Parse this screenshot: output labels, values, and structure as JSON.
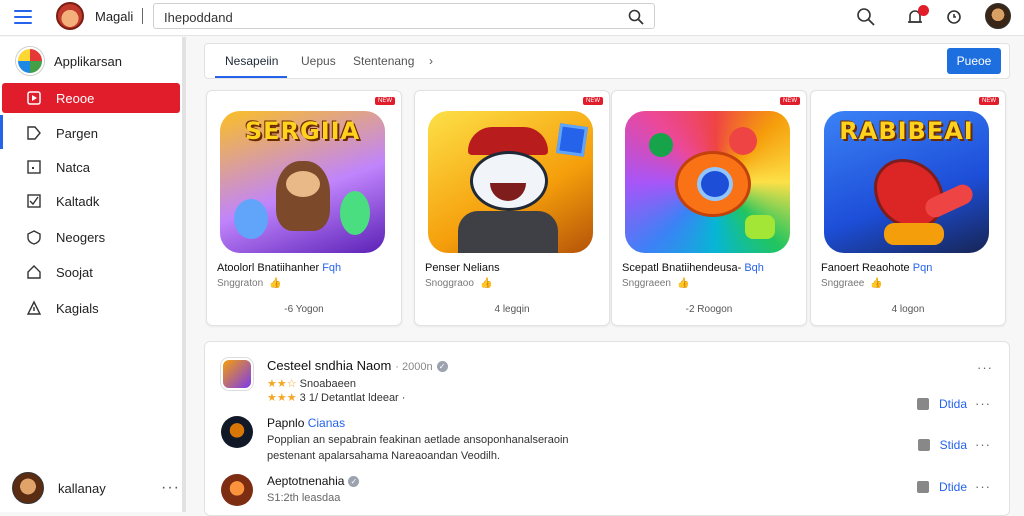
{
  "header": {
    "app_name": "Magali",
    "search": {
      "value": "Ihepoddand",
      "placeholder": ""
    }
  },
  "sidebar": {
    "title": "Applikarsan",
    "items": [
      {
        "label": "Reooe",
        "icon": "play-square-icon",
        "active": true
      },
      {
        "label": "Pargen",
        "icon": "tag-icon",
        "active": false
      },
      {
        "label": "Natca",
        "icon": "square-icon",
        "active": false
      },
      {
        "label": "Kaltadk",
        "icon": "checkbox-icon",
        "active": false
      },
      {
        "label": "Neogers",
        "icon": "shield-icon",
        "active": false
      },
      {
        "label": "Soojat",
        "icon": "home-icon",
        "active": false
      },
      {
        "label": "Kagials",
        "icon": "share-icon",
        "active": false
      }
    ],
    "user": {
      "name": "kallanay",
      "more": "···"
    }
  },
  "tabs": {
    "items": [
      "Nesapeiin",
      "Uepus",
      "Stentenang"
    ],
    "chevron": "›",
    "button": "Pueoe"
  },
  "cards": [
    {
      "badge": "NEW",
      "art_title": "SERGIIA",
      "name": "Atoolorl Bnatiihanher",
      "tag": "Fqh",
      "sub": "Snggraton",
      "count": "-6 Yogon",
      "colors": [
        "#f59e0b",
        "#7c3aed"
      ]
    },
    {
      "badge": "NEW",
      "art_title": "",
      "name": "Penser Nelians",
      "tag": "",
      "sub": "Snoggraoo",
      "count": "4 legqin",
      "colors": [
        "#fbbf24",
        "#f97316"
      ]
    },
    {
      "badge": "NEW",
      "art_title": "",
      "name": "Scepatl Bnatiihendeusa-",
      "tag": "Bqh",
      "sub": "Snggraeen",
      "count": "-2 Roogon",
      "colors": [
        "#22c55e",
        "#ec4899"
      ]
    },
    {
      "badge": "NEW",
      "art_title": "RABIBEAI",
      "name": "Fanoert Reaohote",
      "tag": "Pqn",
      "sub": "Snggraee",
      "count": "4 logon",
      "colors": [
        "#1d4ed8",
        "#60a5fa"
      ]
    }
  ],
  "reviews": [
    {
      "title": "Cesteel sndhia Naom",
      "meta": "· 2000n",
      "stars_line_1": "★★☆",
      "line1": "Snoabaeen",
      "stars_line_2": "★★★",
      "line2": "3 1/ Detantlat ldeear ·",
      "action": "Dtida"
    },
    {
      "title": "Papnlo",
      "title_blue": "Cianas",
      "line1": "Popplian an sepabrain feakinan aetlade ansoponhanalseraoin",
      "line2": "pestenant apalarsahama Nareaoandan Veodilh.",
      "action": "Stida"
    },
    {
      "title": "Aeptotnenahia",
      "line1": "S1:2th leasdaa",
      "action": "Dtide"
    }
  ],
  "colors": {
    "accent": "#e11d2b",
    "primary": "#1d6fe0",
    "link": "#2563eb"
  }
}
